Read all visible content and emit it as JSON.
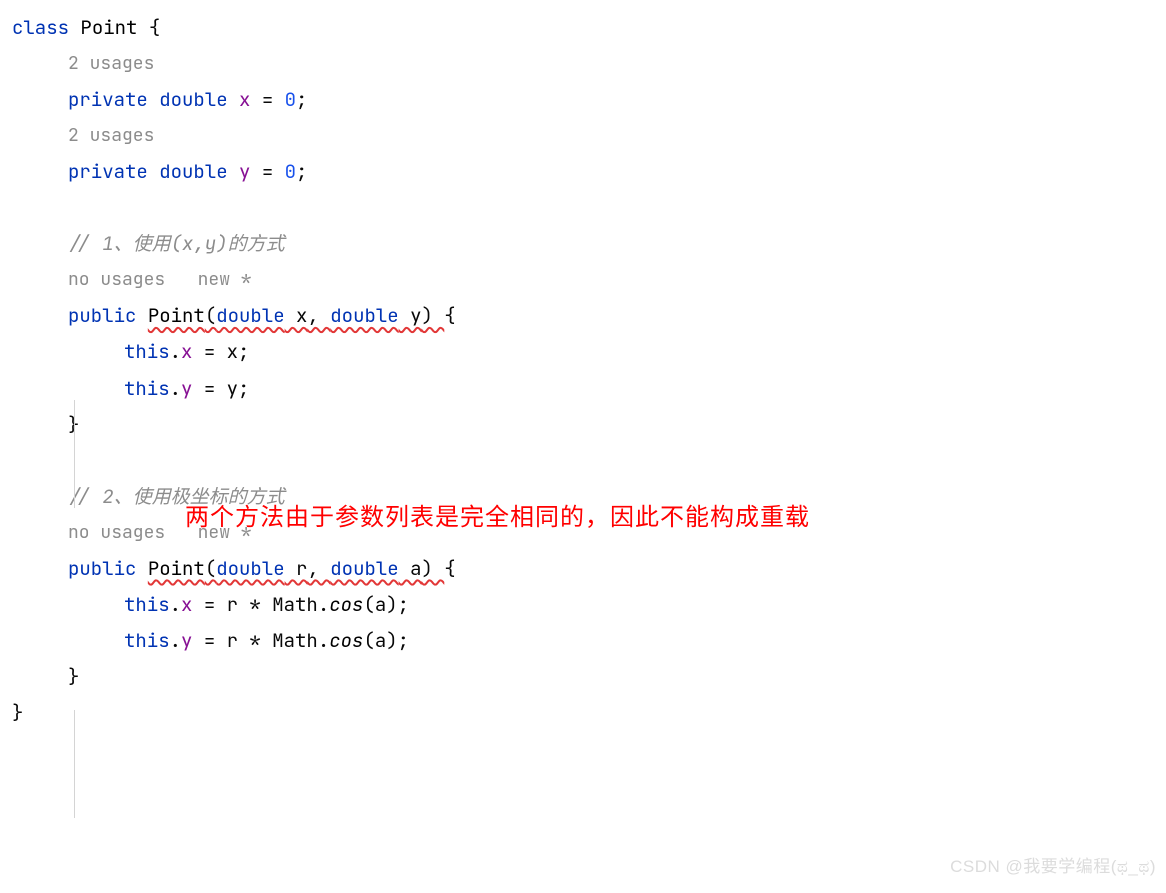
{
  "code": {
    "line1": {
      "kw_class": "class",
      "class_name": " Point ",
      "brace": "{"
    },
    "hint_usages2_a": "2 usages",
    "field_x": {
      "kw": "private",
      "sp1": " ",
      "type": "double",
      "sp2": " ",
      "name": "x",
      "eq": " = ",
      "val": "0",
      "semi": ";"
    },
    "hint_usages2_b": "2 usages",
    "field_y": {
      "kw": "private",
      "sp1": " ",
      "type": "double",
      "sp2": " ",
      "name": "y",
      "eq": " = ",
      "val": "0",
      "semi": ";"
    },
    "comment1": "// 1、使用(x,y)的方式",
    "hint_nousages_a": "no usages   new *",
    "ctor1": {
      "kw": "public",
      "sp": " ",
      "name": "Point",
      "lp": "(",
      "type1": "double",
      "p1": " x",
      "comma": ", ",
      "type2": "double",
      "p2": " y",
      "rp": ") ",
      "brace": "{"
    },
    "body1a": {
      "this": "this",
      "dot": ".",
      "field": "x",
      "rest": " = x;"
    },
    "body1b": {
      "this": "this",
      "dot": ".",
      "field": "y",
      "rest": " = y;"
    },
    "close1": "}",
    "comment2": "// 2、使用极坐标的方式",
    "hint_nousages_b": "no usages   new *",
    "ctor2": {
      "kw": "public",
      "sp": " ",
      "name": "Point",
      "lp": "(",
      "type1": "double",
      "p1": " r",
      "comma": ", ",
      "type2": "double",
      "p2": " a",
      "rp": ") ",
      "brace": "{"
    },
    "body2a": {
      "this": "this",
      "dot": ".",
      "field": "x",
      "rest1": " = r * Math.",
      "cos": "cos",
      "rest2": "(a);"
    },
    "body2b": {
      "this": "this",
      "dot": ".",
      "field": "y",
      "rest1": " = r * Math.",
      "cos": "cos",
      "rest2": "(a);"
    },
    "close2": "}",
    "close_class": "}"
  },
  "annotation": "两个方法由于参数列表是完全相同的，因此不能构成重载",
  "watermark": "CSDN @我要学编程(ಥ_ಥ)"
}
